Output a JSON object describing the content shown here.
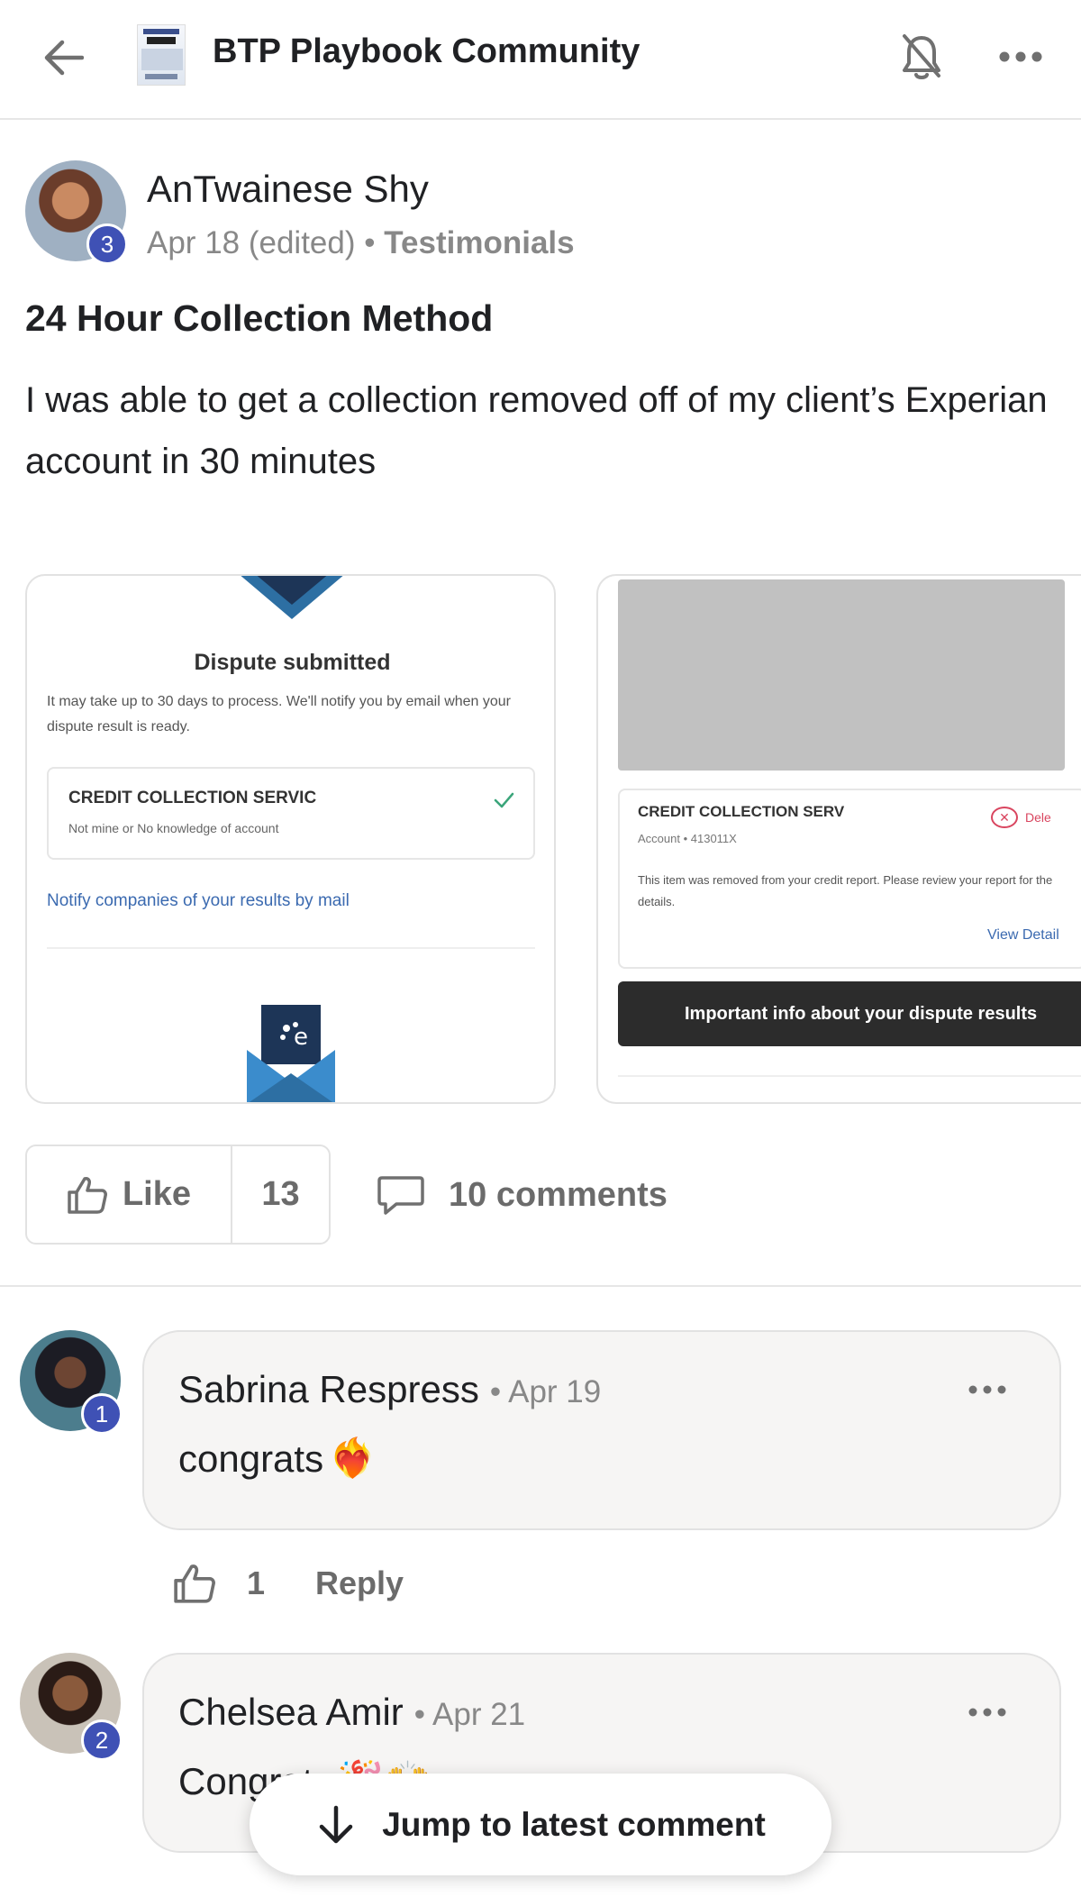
{
  "header": {
    "title": "BTP Playbook Community",
    "icons": {
      "back": "arrow-left-icon",
      "notifications": "bell-off-icon",
      "more": "more-horizontal-icon"
    }
  },
  "post": {
    "author": {
      "name": "AnTwainese Shy",
      "level": "3"
    },
    "date": "Apr 18 (edited)",
    "separator": "•",
    "category": "Testimonials",
    "title": "24 Hour Collection Method",
    "body": "I was able to get a collection removed off of my client’s Experian account in 30 minutes",
    "attachments": [
      {
        "title": "Dispute submitted",
        "description": "It may take up to 30 days to process. We'll notify you by email when your dispute result is ready.",
        "card_title": "CREDIT COLLECTION SERVIC",
        "card_subtitle": "Not mine or No knowledge of account",
        "link": "Notify companies of your results by mail"
      },
      {
        "card_title": "CREDIT COLLECTION SERV",
        "account": "Account • 413011X",
        "delete_label": "Dele",
        "removed_text": "This item was removed from your credit report. Please review your report for the details.",
        "view_details": "View Detail",
        "button_label": "Important info about your dispute results"
      }
    ],
    "actions": {
      "like_label": "Like",
      "like_count": "13",
      "comments_label": "10 comments"
    }
  },
  "comments": [
    {
      "author": "Sabrina Respress",
      "level": "1",
      "date": "Apr 19",
      "text": "congrats",
      "emoji": "❤️‍🔥",
      "like_count": "1",
      "reply_label": "Reply"
    },
    {
      "author": "Chelsea Amir",
      "level": "2",
      "date": "Apr 21",
      "text": "Congrats",
      "emoji": "🎉🙌"
    }
  ],
  "jump": {
    "label": "Jump to latest comment"
  },
  "colors": {
    "badge": "#3f51b5",
    "link": "#3b6ab0",
    "muted": "#888888",
    "danger": "#d9455f"
  }
}
